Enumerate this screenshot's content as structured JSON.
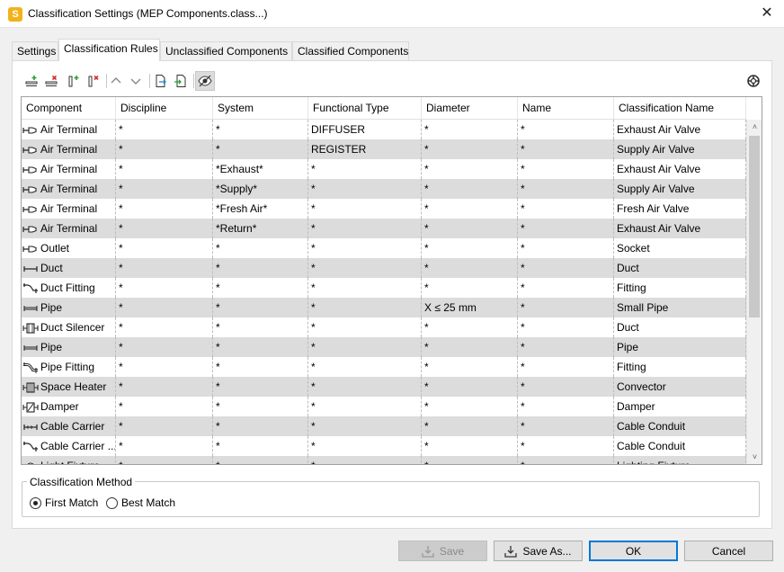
{
  "window": {
    "title": "Classification Settings (MEP Components.class...)",
    "app_icon_letter": "S",
    "close_glyph": "✕"
  },
  "tabs": [
    {
      "label": "Settings",
      "active": false
    },
    {
      "label": "Classification Rules",
      "active": true
    },
    {
      "label": "Unclassified Components",
      "active": false
    },
    {
      "label": "Classified Components",
      "active": false
    }
  ],
  "toolbar": {
    "buttons": [
      {
        "name": "add-row-icon"
      },
      {
        "name": "delete-row-icon"
      },
      {
        "name": "add-column-icon"
      },
      {
        "name": "delete-column-icon"
      },
      {
        "name": "move-up-icon"
      },
      {
        "name": "move-down-icon"
      },
      {
        "name": "export-icon"
      },
      {
        "name": "import-icon"
      },
      {
        "name": "toggle-visibility-icon",
        "pressed": true
      }
    ],
    "help_icon": "lifebuoy-icon"
  },
  "grid": {
    "columns": [
      "Component",
      "Discipline",
      "System",
      "Functional Type",
      "Diameter",
      "Name",
      "Classification Name"
    ],
    "rows": [
      {
        "icon": "air-terminal-icon",
        "cells": [
          "Air Terminal",
          "*",
          "*",
          "DIFFUSER",
          "*",
          "*",
          "Exhaust Air Valve"
        ]
      },
      {
        "icon": "air-terminal-icon",
        "cells": [
          "Air Terminal",
          "*",
          "*",
          "REGISTER",
          "*",
          "*",
          "Supply Air Valve"
        ]
      },
      {
        "icon": "air-terminal-icon",
        "cells": [
          "Air Terminal",
          "*",
          "*Exhaust*",
          "*",
          "*",
          "*",
          "Exhaust Air Valve"
        ]
      },
      {
        "icon": "air-terminal-icon",
        "cells": [
          "Air Terminal",
          "*",
          "*Supply*",
          "*",
          "*",
          "*",
          "Supply Air Valve"
        ]
      },
      {
        "icon": "air-terminal-icon",
        "cells": [
          "Air Terminal",
          "*",
          "*Fresh Air*",
          "*",
          "*",
          "*",
          "Fresh Air Valve"
        ]
      },
      {
        "icon": "air-terminal-icon",
        "cells": [
          "Air Terminal",
          "*",
          "*Return*",
          "*",
          "*",
          "*",
          "Exhaust Air Valve"
        ]
      },
      {
        "icon": "outlet-icon",
        "cells": [
          "Outlet",
          "*",
          "*",
          "*",
          "*",
          "*",
          "Socket"
        ]
      },
      {
        "icon": "duct-icon",
        "cells": [
          "Duct",
          "*",
          "*",
          "*",
          "*",
          "*",
          "Duct"
        ]
      },
      {
        "icon": "duct-fitting-icon",
        "cells": [
          "Duct Fitting",
          "*",
          "*",
          "*",
          "*",
          "*",
          "Fitting"
        ]
      },
      {
        "icon": "pipe-icon",
        "cells": [
          "Pipe",
          "*",
          "*",
          "*",
          "X ≤ 25 mm",
          "*",
          "Small Pipe"
        ]
      },
      {
        "icon": "duct-silencer-icon",
        "cells": [
          "Duct Silencer",
          "*",
          "*",
          "*",
          "*",
          "*",
          "Duct"
        ]
      },
      {
        "icon": "pipe-icon",
        "cells": [
          "Pipe",
          "*",
          "*",
          "*",
          "*",
          "*",
          "Pipe"
        ]
      },
      {
        "icon": "pipe-fitting-icon",
        "cells": [
          "Pipe Fitting",
          "*",
          "*",
          "*",
          "*",
          "*",
          "Fitting"
        ]
      },
      {
        "icon": "space-heater-icon",
        "cells": [
          "Space Heater",
          "*",
          "*",
          "*",
          "*",
          "*",
          "Convector"
        ]
      },
      {
        "icon": "damper-icon",
        "cells": [
          "Damper",
          "*",
          "*",
          "*",
          "*",
          "*",
          "Damper"
        ]
      },
      {
        "icon": "cable-carrier-icon",
        "cells": [
          "Cable Carrier",
          "*",
          "*",
          "*",
          "*",
          "*",
          "Cable Conduit"
        ]
      },
      {
        "icon": "cable-carrier-fitting-icon",
        "cells": [
          "Cable Carrier ...",
          "*",
          "*",
          "*",
          "*",
          "*",
          "Cable Conduit"
        ]
      },
      {
        "icon": "light-fixture-icon",
        "cells": [
          "Light Fixture",
          "*",
          "*",
          "*",
          "*",
          "*",
          "Lighting Fixture"
        ]
      }
    ],
    "scrollbar": {
      "up_glyph": "˄",
      "down_glyph": "˅"
    }
  },
  "classification_method": {
    "legend": "Classification Method",
    "options": [
      {
        "label": "First Match",
        "checked": true
      },
      {
        "label": "Best Match",
        "checked": false
      }
    ]
  },
  "buttons": {
    "save": "Save",
    "save_as": "Save As...",
    "ok": "OK",
    "cancel": "Cancel"
  },
  "colors": {
    "alt_row": "#dcdcdc",
    "default_button_border": "#0078d7",
    "app_icon": "#f2b21c"
  }
}
